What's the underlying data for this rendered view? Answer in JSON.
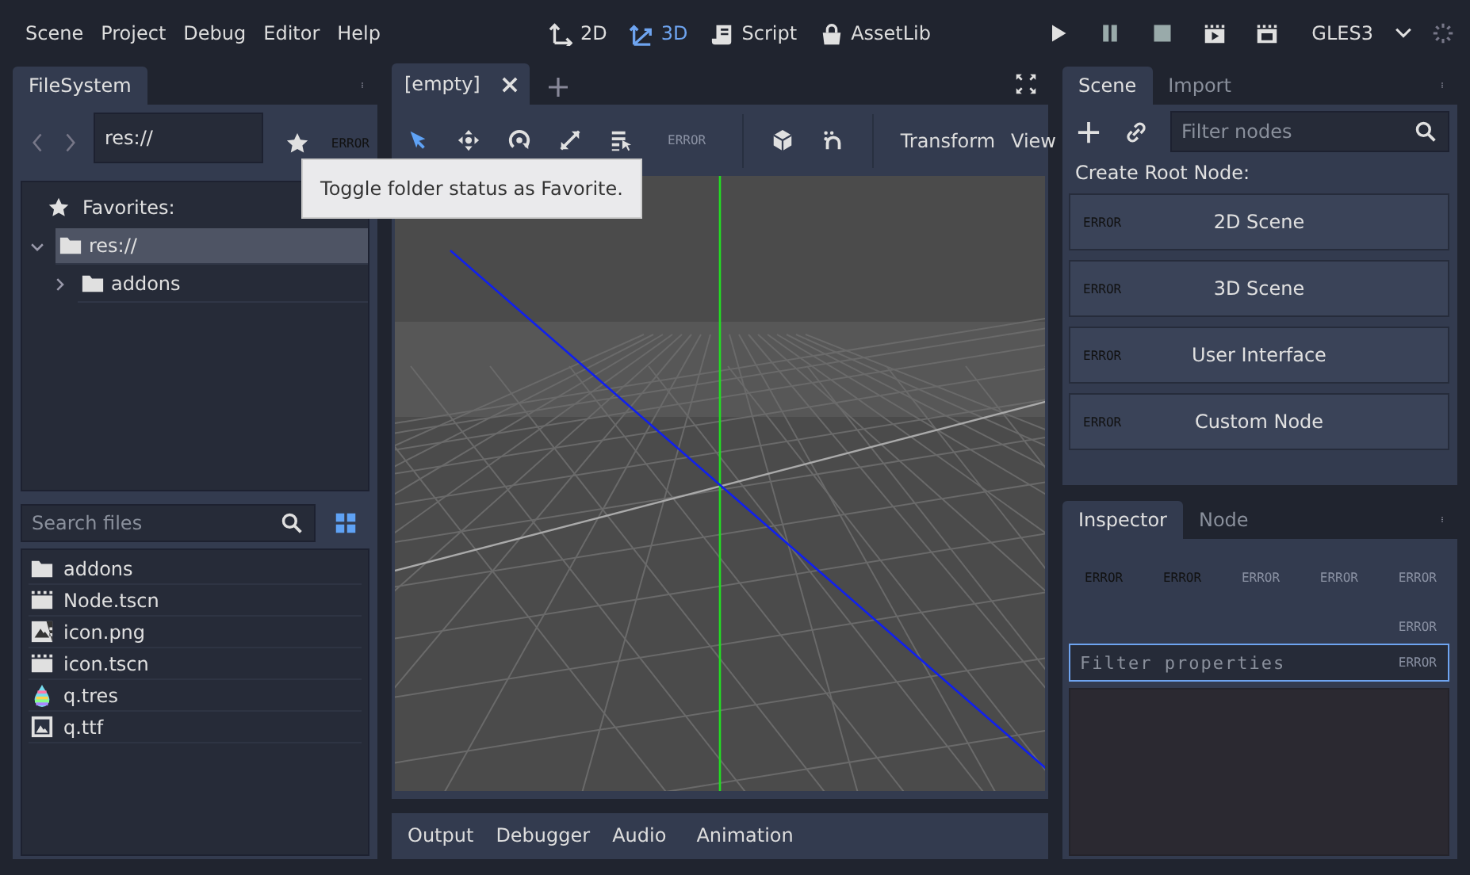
{
  "menu": [
    "Scene",
    "Project",
    "Debug",
    "Editor",
    "Help"
  ],
  "workspaces": [
    {
      "label": "2D",
      "kind": "planar",
      "selected": false
    },
    {
      "label": "3D",
      "kind": "spatial",
      "selected": true
    },
    {
      "label": "Script",
      "kind": "script",
      "selected": false
    },
    {
      "label": "AssetLib",
      "kind": "assetlib",
      "selected": false
    }
  ],
  "renderer": "GLES3",
  "filesystem": {
    "tab": "FileSystem",
    "path": "res://",
    "missing_icon": "ERROR",
    "favorites": "Favorites:",
    "tree": [
      {
        "label": "res://",
        "selected": true,
        "expanded": true,
        "children": [
          {
            "label": "addons",
            "selected": false,
            "expanded": false
          }
        ]
      }
    ],
    "search": {
      "placeholder": "Search files"
    },
    "files": [
      {
        "name": "addons",
        "kind": "folder"
      },
      {
        "name": "Node.tscn",
        "kind": "scene"
      },
      {
        "name": "icon.png",
        "kind": "image"
      },
      {
        "name": "icon.tscn",
        "kind": "scene"
      },
      {
        "name": "q.tres",
        "kind": "resource"
      },
      {
        "name": "q.ttf",
        "kind": "font"
      }
    ]
  },
  "editor": {
    "tab": "[empty]",
    "missing_icon": "ERROR",
    "menus": [
      "Transform",
      "View"
    ]
  },
  "tooltip": "Toggle folder status as Favorite.",
  "bottom_tabs": [
    "Output",
    "Debugger",
    "Audio",
    "Animation"
  ],
  "scene_dock": {
    "tabs": [
      {
        "label": "Scene",
        "selected": true
      },
      {
        "label": "Import",
        "selected": false
      }
    ],
    "filter": {
      "placeholder": "Filter nodes"
    },
    "heading": "Create Root Node:",
    "buttons": [
      {
        "icon": "ERROR",
        "label": "2D Scene"
      },
      {
        "icon": "ERROR",
        "label": "3D Scene"
      },
      {
        "icon": "ERROR",
        "label": "User Interface"
      },
      {
        "icon": "ERROR",
        "label": "Custom Node"
      }
    ]
  },
  "inspector": {
    "tabs": [
      {
        "label": "Inspector",
        "selected": true
      },
      {
        "label": "Node",
        "selected": false
      }
    ],
    "toolbar": [
      {
        "label": "ERROR",
        "disabled": false
      },
      {
        "label": "ERROR",
        "disabled": false
      },
      {
        "label": "ERROR",
        "disabled": true
      },
      {
        "label": "ERROR",
        "disabled": true
      },
      {
        "label": "ERROR",
        "disabled": true
      }
    ],
    "history": {
      "label": "ERROR",
      "disabled": true
    },
    "filter": {
      "placeholder": "Filter properties",
      "icon": "ERROR"
    }
  }
}
